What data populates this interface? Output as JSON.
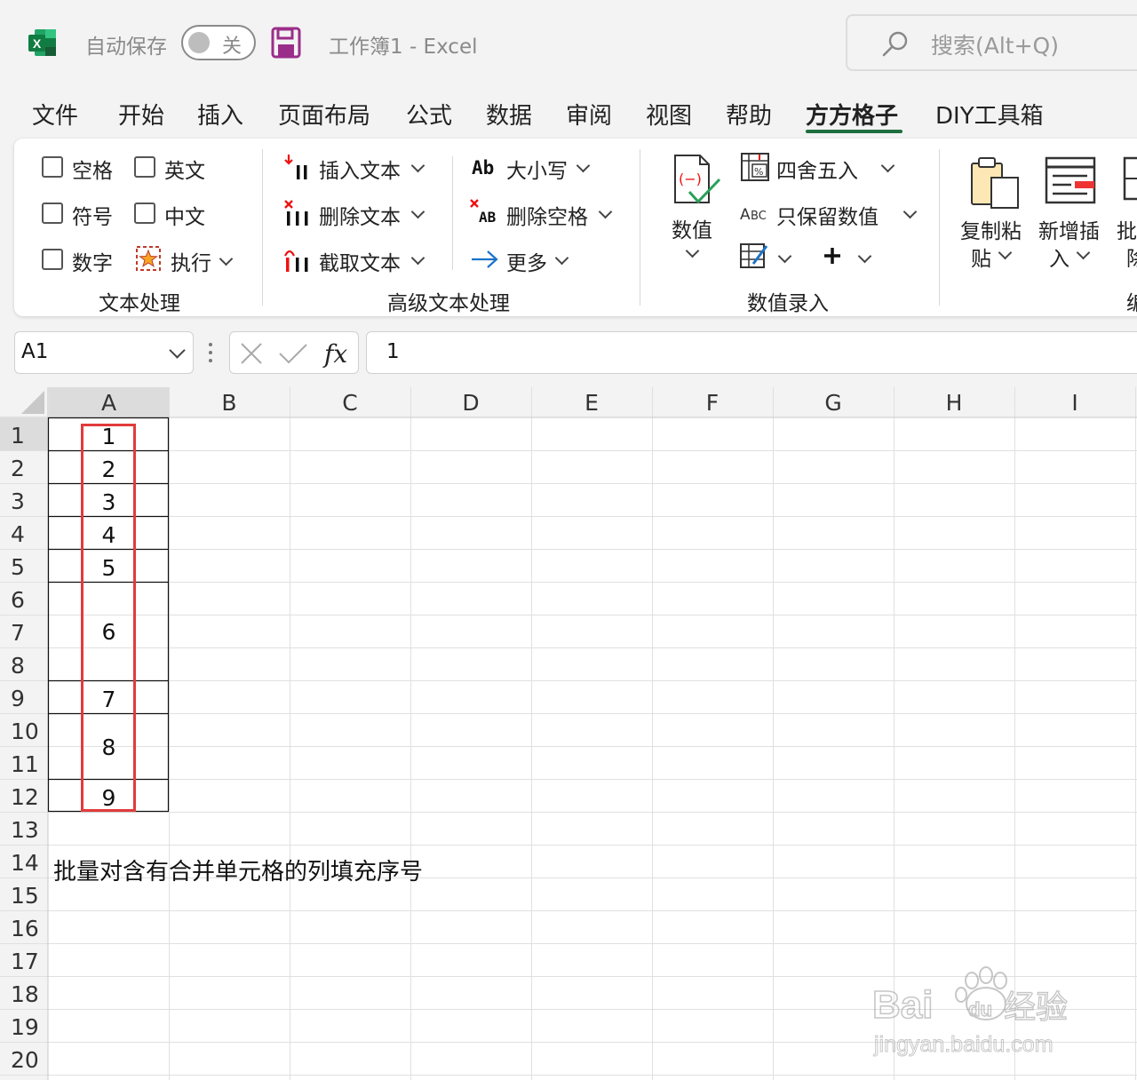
{
  "title_bar": {
    "autosave_label": "自动保存",
    "autosave_state": "关",
    "window_title": "工作簿1  -  Excel",
    "search_placeholder": "搜索(Alt+Q)"
  },
  "menu_tabs": [
    "文件",
    "开始",
    "插入",
    "页面布局",
    "公式",
    "数据",
    "审阅",
    "视图",
    "帮助",
    "方方格子",
    "DIY工具箱"
  ],
  "active_tab": "方方格子",
  "ribbon": {
    "text_group": {
      "label": "文本处理",
      "checkboxes": [
        "空格",
        "英文",
        "符号",
        "中文",
        "数字"
      ],
      "execute": "执行"
    },
    "advanced_group": {
      "label": "高级文本处理",
      "insert_text": "插入文本",
      "delete_text": "删除文本",
      "extract_text": "截取文本",
      "case": "大小写",
      "delete_space": "删除空格",
      "more": "更多"
    },
    "numeric_group": {
      "label": "数值录入",
      "value": "数值",
      "round": "四舍五入",
      "keep_numeric": "只保留数值"
    },
    "paste_group": {
      "copy_paste_1": "复制粘",
      "copy_paste_2": "贴",
      "new_insert_1": "新增插",
      "new_insert_2": "入",
      "batch_1": "批",
      "batch_2": "除",
      "group_label_partial": "编"
    }
  },
  "formula_bar": {
    "name_box": "A1",
    "value": "1"
  },
  "columns": [
    "A",
    "B",
    "C",
    "D",
    "E",
    "F",
    "G",
    "H",
    "I"
  ],
  "rows": [
    "1",
    "2",
    "3",
    "4",
    "5",
    "6",
    "7",
    "8",
    "9",
    "10",
    "11",
    "12",
    "13",
    "14",
    "15",
    "16",
    "17",
    "18",
    "19",
    "20"
  ],
  "column_a_values": [
    "1",
    "2",
    "3",
    "4",
    "5",
    "6",
    "7",
    "8",
    "9"
  ],
  "note_text": "批量对含有合并单元格的列填充序号",
  "watermark": {
    "brand": "Bai du 经验",
    "url": "jingyan.baidu.com"
  }
}
